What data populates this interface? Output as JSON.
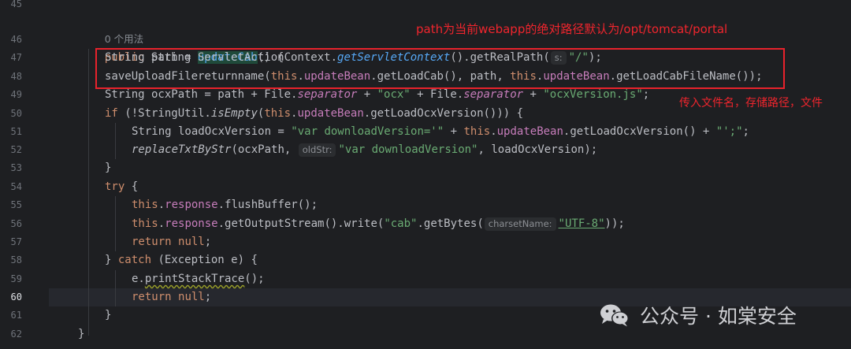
{
  "editor": {
    "usage_hint": "0 个用法",
    "line_numbers": [
      "45",
      "46",
      "47",
      "48",
      "49",
      "50",
      "51",
      "52",
      "53",
      "54",
      "55",
      "56",
      "57",
      "58",
      "59",
      "60",
      "61",
      "62"
    ],
    "current_line": "60",
    "code": {
      "l46_public": "public",
      "l46_type": "String",
      "l46_method": "updateCab",
      "l46_tail": "() {",
      "l47_a": "String path = ServletActionContext.",
      "l47_fn": "getServletContext",
      "l47_b": "().getRealPath(",
      "l47_hint": "s:",
      "l47_str": "\"/\"",
      "l47_c": ");",
      "l48_a": "saveUploadFilereturnname(",
      "l48_this1": "this",
      "l48_dot1": ".",
      "l48_fld1": "updateBean",
      "l48_b": ".getLoadCab(), path, ",
      "l48_this2": "this",
      "l48_dot2": ".",
      "l48_fld2": "updateBean",
      "l48_c": ".getLoadCabFileName());",
      "l49_a": "String ocxPath = path + File.",
      "l49_sep1": "separator",
      "l49_b": " + ",
      "l49_str1": "\"ocx\"",
      "l49_c": " + File.",
      "l49_sep2": "separator",
      "l49_d": " + ",
      "l49_str2": "\"ocxVersion.js\"",
      "l49_e": ";",
      "l50_if": "if",
      "l50_a": " (!StringUtil.",
      "l50_fn": "isEmpty",
      "l50_b": "(",
      "l50_this": "this",
      "l50_dot": ".",
      "l50_fld": "updateBean",
      "l50_c": ".getLoadOcxVersion())) {",
      "l51_a": "String loadOcxVersion = ",
      "l51_str1": "\"var downloadVersion='\"",
      "l51_b": " + ",
      "l51_this": "this",
      "l51_dot": ".",
      "l51_fld": "updateBean",
      "l51_c": ".getLoadOcxVersion() + ",
      "l51_str2": "\"';\"",
      "l51_d": ";",
      "l52_fn": "replaceTxtByStr",
      "l52_a": "(ocxPath, ",
      "l52_hint": "oldStr:",
      "l52_str": "\"var downloadVersion\"",
      "l52_b": ", loadOcxVersion);",
      "l53": "}",
      "l54_kw": "try",
      "l54_a": " {",
      "l55_this": "this",
      "l55_dot": ".",
      "l55_fld": "response",
      "l55_a": ".flushBuffer();",
      "l56_this": "this",
      "l56_dot": ".",
      "l56_fld": "response",
      "l56_a": ".getOutputStream().write(",
      "l56_str1": "\"cab\"",
      "l56_b": ".getBytes(",
      "l56_hint": "charsetName:",
      "l56_str2": "\"UTF-8\"",
      "l56_c": "));",
      "l57_kw": "return",
      "l57_a": " ",
      "l57_null": "null",
      "l57_b": ";",
      "l58_a": "} ",
      "l58_kw": "catch",
      "l58_b": " (Exception e) {",
      "l59_a": "e.",
      "l59_sq": "printStackTrace",
      "l59_b": "();",
      "l60_kw": "return",
      "l60_a": " ",
      "l60_null": "null",
      "l60_b": ";",
      "l61": "}",
      "l62": "}"
    }
  },
  "annotations": {
    "path_note": "path为当前webapp的绝对路径默认为/opt/tomcat/portal",
    "params_note": "传入文件名，存储路径，文件"
  },
  "watermark": {
    "icon": "wechat-icon",
    "text": "公众号 · 如棠安全"
  },
  "colors": {
    "background": "#1e1f22",
    "keyword": "#cf8e6d",
    "string": "#6aab73",
    "field": "#c77dbb",
    "method": "#56a8f5",
    "annotation_red": "#e8222c"
  }
}
